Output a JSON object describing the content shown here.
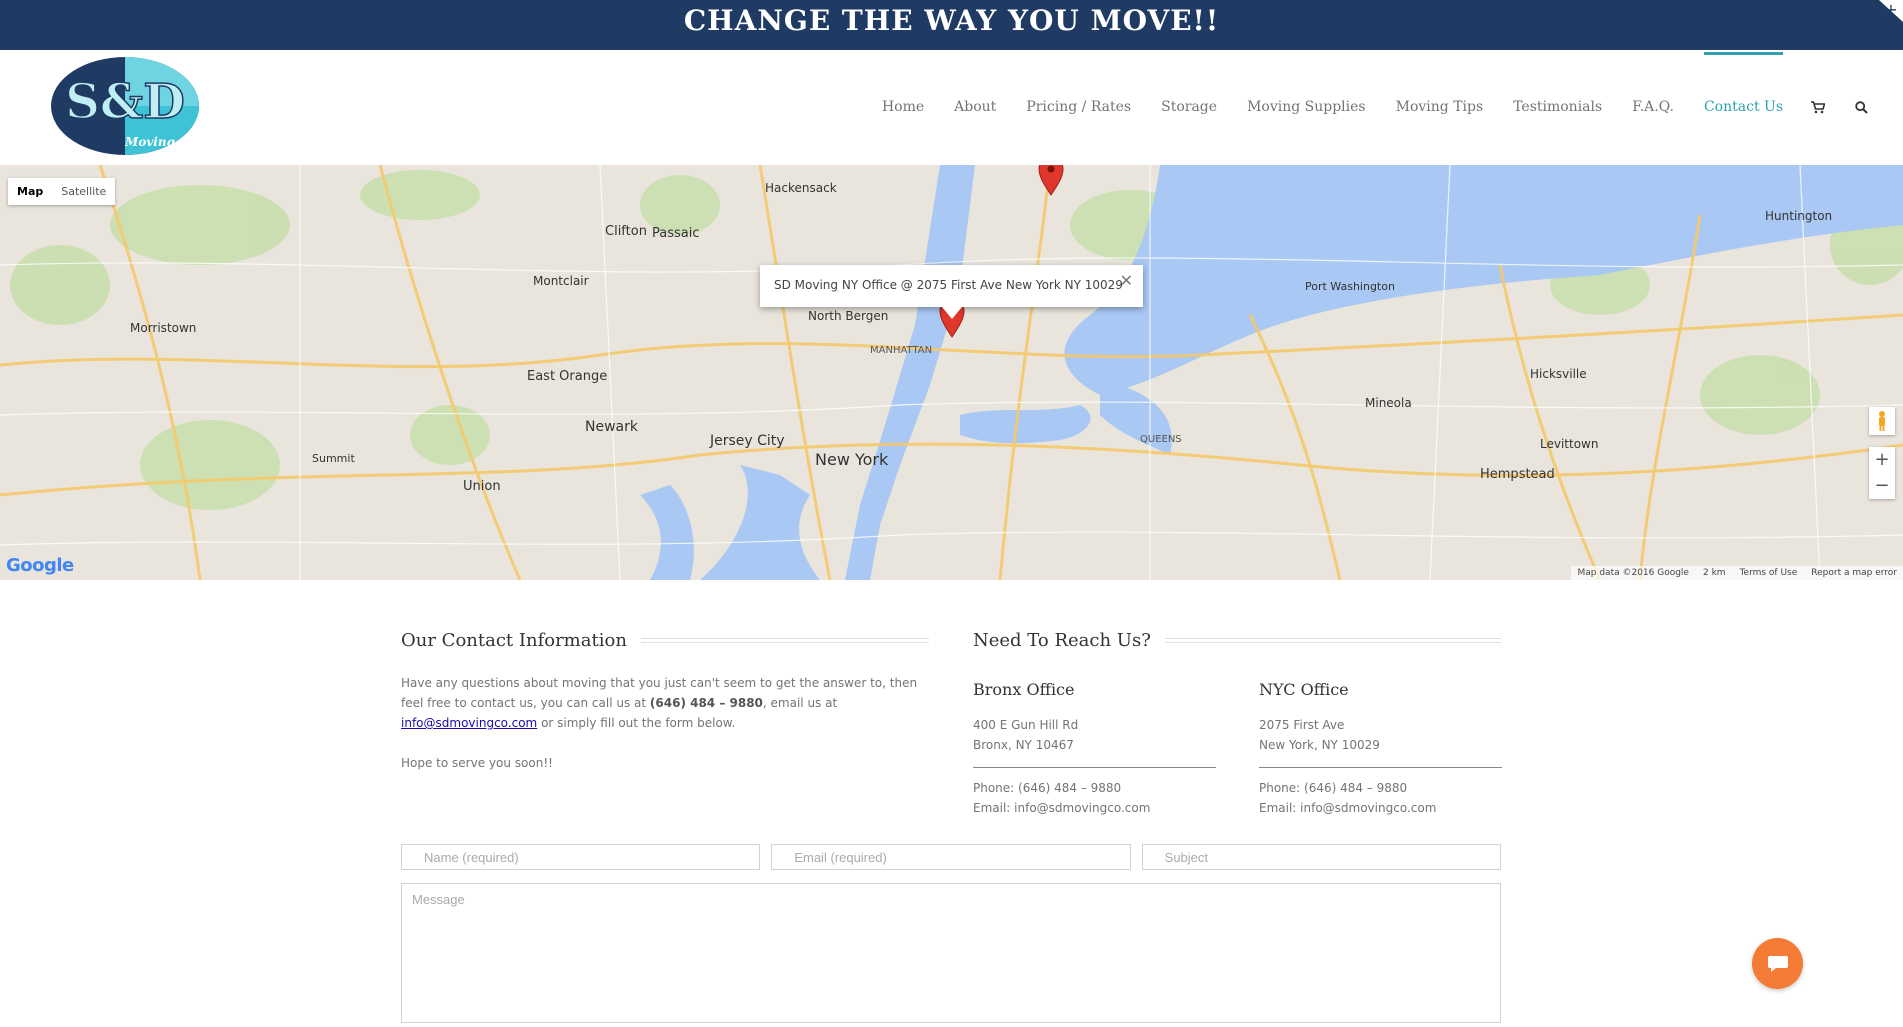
{
  "promo_bar": {
    "text": "CHANGE THE WAY YOU MOVE!!",
    "close_glyph": "+"
  },
  "header": {
    "logo": {
      "letters": "S&D",
      "tagline": "Moving",
      "icon": "company-logo"
    },
    "nav": [
      {
        "label": "Home"
      },
      {
        "label": "About"
      },
      {
        "label": "Pricing / Rates"
      },
      {
        "label": "Storage"
      },
      {
        "label": "Moving Supplies"
      },
      {
        "label": "Moving Tips"
      },
      {
        "label": "Testimonials"
      },
      {
        "label": "F.A.Q."
      },
      {
        "label": "Contact Us",
        "active": true
      }
    ],
    "icons": {
      "cart": "cart-icon",
      "search": "search-icon"
    },
    "accent_color": "#2e9fb0"
  },
  "map": {
    "type_buttons": [
      "Map",
      "Satellite"
    ],
    "selected_type": "Map",
    "info_window": "SD Moving NY Office @ 2075 First Ave New York NY 10029",
    "labels": {
      "new_york": "New York",
      "jersey_city": "Jersey City",
      "newark": "Newark",
      "north_bergen": "North Bergen",
      "manhattan": "MANHATTAN",
      "queens": "QUEENS",
      "hackensack": "Hackensack",
      "hempstead": "Hempstead",
      "huntington": "Huntington",
      "port_washington": "Port Washington",
      "clifton": "Clifton",
      "passaic": "Passaic",
      "montclair": "Montclair",
      "east_orange": "East Orange",
      "morristown": "Morristown",
      "levittown": "Levittown",
      "hicksville": "Hicksville",
      "mineola": "Mineola",
      "union": "Union",
      "summit": "Summit"
    },
    "google_logo": "Google",
    "footer": {
      "data": "Map data ©2016 Google",
      "scale": "2 km",
      "terms": "Terms of Use",
      "report": "Report a map error"
    },
    "zoom_in": "+",
    "zoom_out": "−"
  },
  "contact": {
    "title": "Our Contact Information",
    "intro_a": "Have any questions about moving that you just can't seem to get the answer to, then  feel free to contact us, you can call us at ",
    "phone_bold": "(646) 484 – 9880",
    "intro_b": ", email us at ",
    "email_link": "info@sdmovingco.com",
    "intro_c": " or simply fill out the form below.",
    "closing": "Hope to serve you soon!!"
  },
  "reach": {
    "title": "Need To Reach Us?",
    "offices": [
      {
        "name": "Bronx Office",
        "line1": "400 E Gun Hill Rd",
        "line2": "Bronx, NY 10467",
        "phone": "Phone: (646) 484 – 9880",
        "email": "Email: info@sdmovingco.com"
      },
      {
        "name": "NYC Office",
        "line1": "2075 First Ave",
        "line2": "New York, NY 10029",
        "phone": "Phone: (646) 484 – 9880",
        "email": "Email: info@sdmovingco.com"
      }
    ]
  },
  "form": {
    "name_placeholder": "Name (required)",
    "email_placeholder": "Email (required)",
    "subject_placeholder": "Subject",
    "message_placeholder": "Message"
  },
  "chat": {
    "icon": "chat-bubble-icon",
    "color": "#f47b36"
  }
}
